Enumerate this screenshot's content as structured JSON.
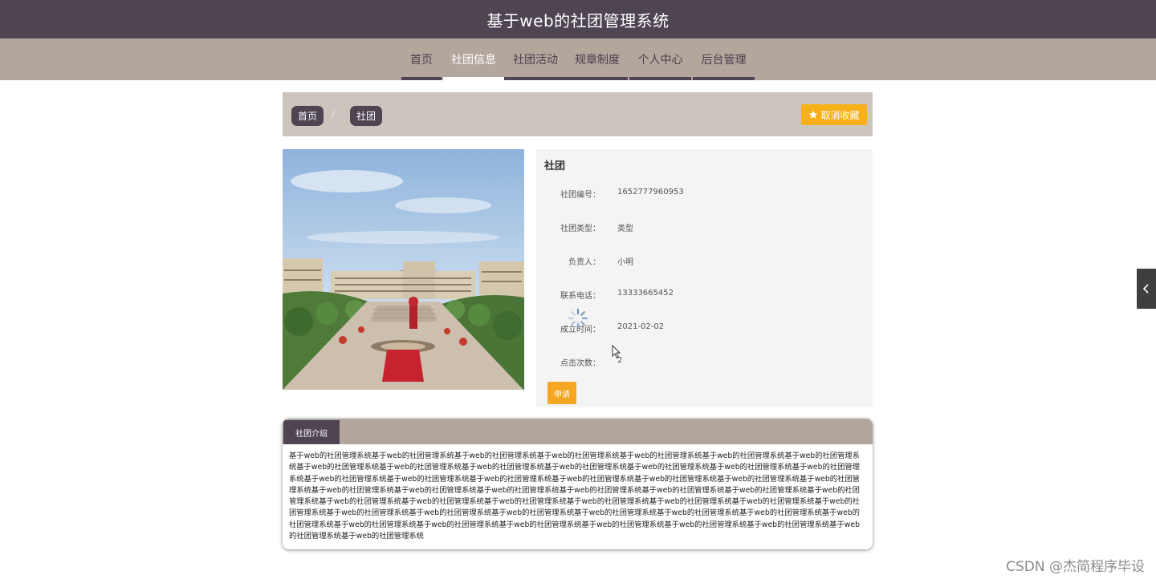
{
  "header": {
    "title": "基于web的社团管理系统"
  },
  "nav": {
    "items": [
      {
        "label": "首页"
      },
      {
        "label": "社团信息"
      },
      {
        "label": "社团活动"
      },
      {
        "label": "规章制度"
      },
      {
        "label": "个人中心"
      },
      {
        "label": "后台管理"
      }
    ],
    "active_index": 1
  },
  "breadcrumb": {
    "home": "首页",
    "separator": "/",
    "current": "社团"
  },
  "favorite_button": {
    "label": "取消收藏",
    "icon": "star-icon"
  },
  "club": {
    "title": "社团",
    "fields": [
      {
        "label": "社团编号：",
        "value": "1652777960953"
      },
      {
        "label": "社团类型：",
        "value": "类型"
      },
      {
        "label": "负责人：",
        "value": "小明"
      },
      {
        "label": "联系电话：",
        "value": "13333665452"
      },
      {
        "label": "成立时间：",
        "value": "2021-02-02"
      },
      {
        "label": "点击次数：",
        "value": "2"
      }
    ],
    "apply_label": "申请"
  },
  "intro": {
    "tab_label": "社团介绍",
    "text": "基于web的社团管理系统基于web的社团管理系统基于web的社团管理系统基于web的社团管理系统基于web的社团管理系统基于web的社团管理系统基于web的社团管理系统基于web的社团管理系统基于web的社团管理系统基于web的社团管理系统基于web的社团管理系统基于web的社团管理系统基于web的社团管理系统基于web的社团管理系统基于web的社团管理系统基于web的社团管理系统基于web的社团管理系统基于web的社团管理系统基于web的社团管理系统基于web的社团管理系统基于web的社团管理系统基于web的社团管理系统基于web的社团管理系统基于web的社团管理系统基于web的社团管理系统基于web的社团管理系统基于web的社团管理系统基于web的社团管理系统基于web的社团管理系统基于web的社团管理系统基于web的社团管理系统基于web的社团管理系统基于web的社团管理系统基于web的社团管理系统基于web的社团管理系统基于web的社团管理系统基于web的社团管理系统基于web的社团管理系统基于web的社团管理系统基于web的社团管理系统基于web的社团管理系统基于web的社团管理系统基于web的社团管理系统基于web的社团管理系统基于web的社团管理系统基于web的社团管理系统基于web的社团管理系统基于web的社团管理系统基于web的社团管理系统基于web的社团管理系统"
  },
  "watermark": "CSDN @杰简程序毕设",
  "colors": {
    "header_bg": "#4e4452",
    "nav_bg": "#b3a69d",
    "breadcrumb_bg": "#ccc5bd",
    "favorite_button": "#f6b11a",
    "apply_button": "#f5a623",
    "info_panel_bg": "#f4f4f4"
  }
}
